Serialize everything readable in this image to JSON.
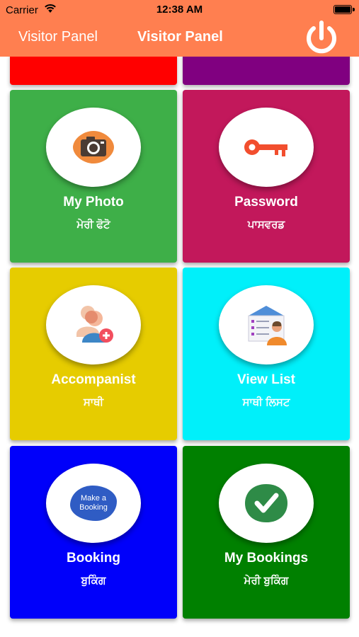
{
  "status_bar": {
    "carrier": "Carrier",
    "time": "12:38 AM"
  },
  "nav": {
    "back_label": "Visitor Panel",
    "title": "Visitor Panel"
  },
  "colors": {
    "header": "#FF7F50",
    "top_left_partial": "#FF0000",
    "top_right_partial": "#800080",
    "my_photo": "#3EAF48",
    "password": "#C2185B",
    "accompanist": "#E6CC00",
    "view_list": "#00F0FA",
    "booking": "#0000FA",
    "my_bookings": "#008000"
  },
  "tiles": [
    {
      "icon": "camera-icon",
      "label_en": "My Photo",
      "label_pa": "ਮੇਰੀ ਫੋਟੋ"
    },
    {
      "icon": "key-icon",
      "label_en": "Password",
      "label_pa": "ਪਾਸਵਰਡ"
    },
    {
      "icon": "add-user-icon",
      "label_en": "Accompanist",
      "label_pa": "ਸਾਥੀ"
    },
    {
      "icon": "contact-list-icon",
      "label_en": "View List",
      "label_pa": "ਸਾਥੀ ਲਿਸਟ"
    },
    {
      "icon": "make-booking-icon",
      "icon_text": "Make a Booking",
      "label_en": "Booking",
      "label_pa": "ਬੁਕਿੰਗ"
    },
    {
      "icon": "checkmark-icon",
      "label_en": "My Bookings",
      "label_pa": "ਮੇਰੀ ਬੁਕਿੰਗ"
    }
  ]
}
